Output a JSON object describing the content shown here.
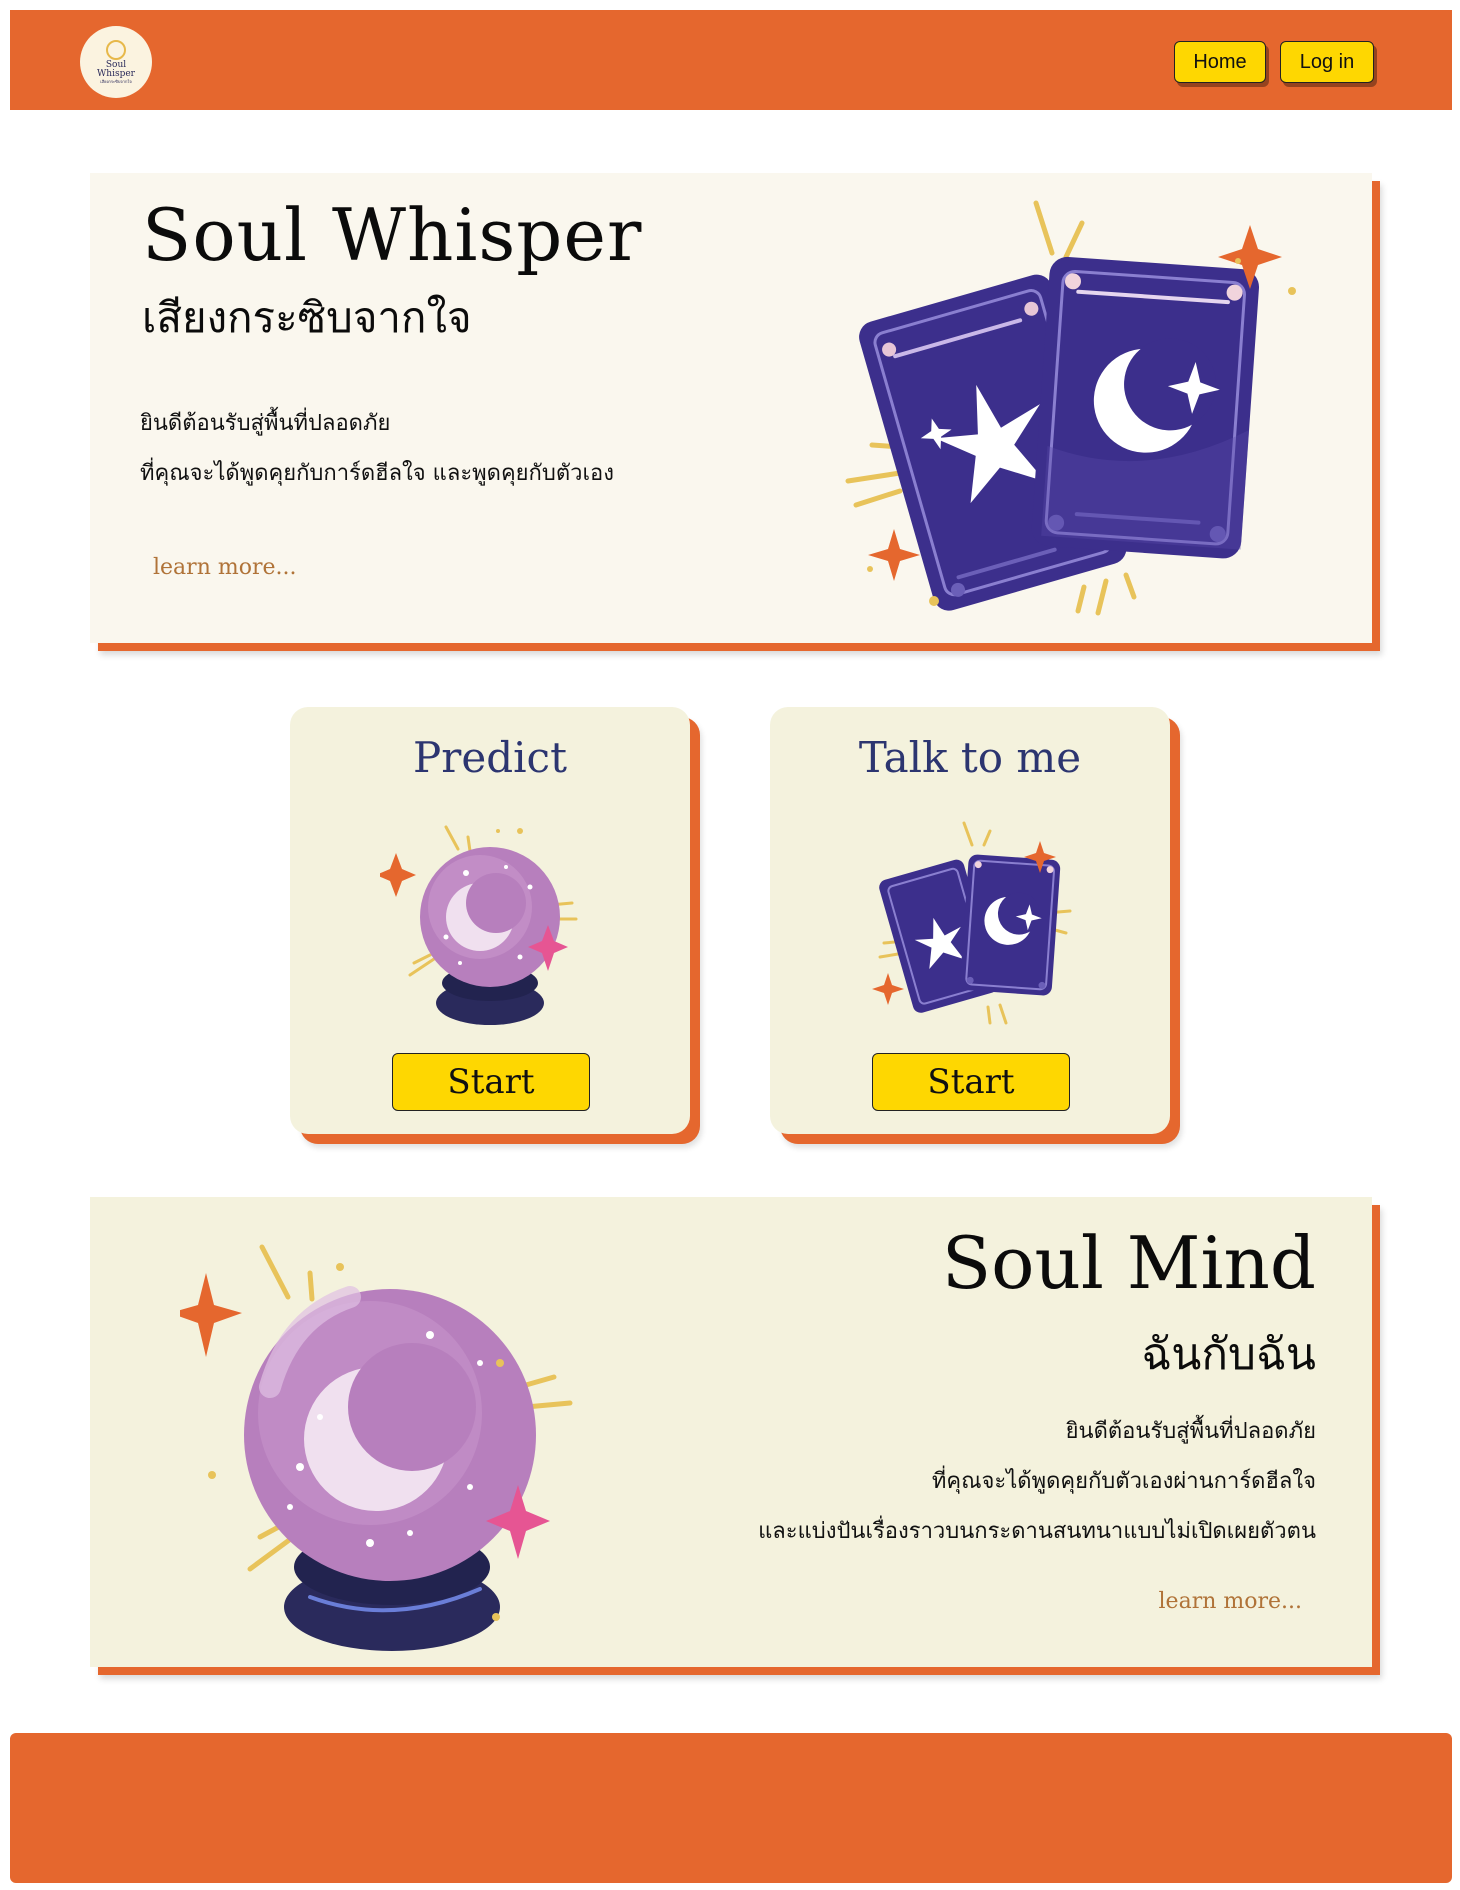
{
  "header": {
    "logo": {
      "line1": "Soul",
      "line2": "Whisper",
      "line3": "เสียงกระซิบจากใจ"
    },
    "nav": {
      "home": "Home",
      "login": "Log in"
    }
  },
  "hero": {
    "title": "Soul Whisper",
    "subtitle": "เสียงกระซิบจากใจ",
    "line1": "ยินดีต้อนรับสู่พื้นที่ปลอดภัย",
    "line2": "ที่คุณจะได้พูดคุยกับการ์ดฮีลใจ และพูดคุยกับตัวเอง",
    "learn_more": "learn more..."
  },
  "cards": [
    {
      "title": "Predict",
      "button": "Start",
      "icon": "crystal-ball-icon"
    },
    {
      "title": "Talk to me",
      "button": "Start",
      "icon": "tarot-cards-icon"
    }
  ],
  "soul_mind": {
    "title": "Soul Mind",
    "subtitle": "ฉันกับฉัน",
    "line1": "ยินดีต้อนรับสู่พื้นที่ปลอดภัย",
    "line2": "ที่คุณจะได้พูดคุยกับตัวเองผ่านการ์ดฮีลใจ",
    "line3": "และแบ่งปันเรื่องราวบนกระดานสนทนาแบบไม่เปิดเผยตัวตน",
    "learn_more": "learn more..."
  },
  "colors": {
    "accent": "#e5672e",
    "button": "#fed701",
    "hero_bg": "#faf7ee",
    "card_bg": "#f4f2dd",
    "heading_blue": "#2c3570",
    "link": "#b07338"
  }
}
